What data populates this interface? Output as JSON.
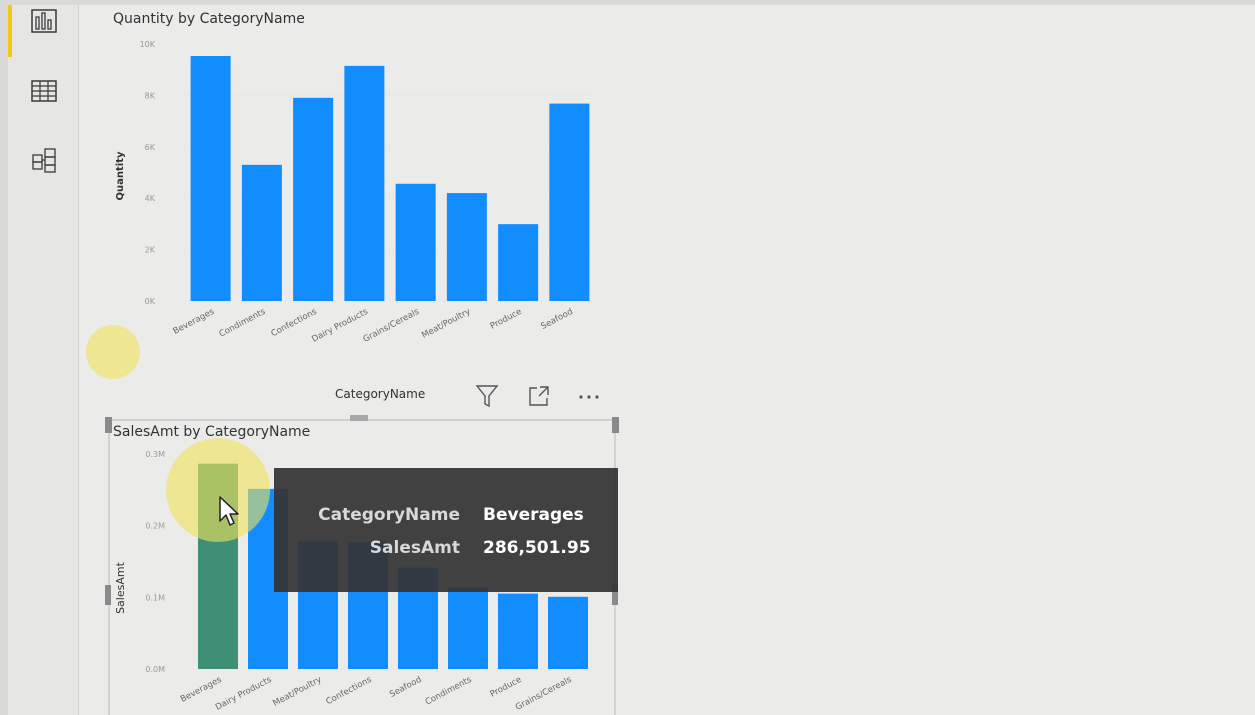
{
  "nav": {
    "items": [
      {
        "name": "report-view-icon",
        "active": true
      },
      {
        "name": "data-view-icon",
        "active": false
      },
      {
        "name": "model-view-icon",
        "active": false
      }
    ]
  },
  "colors": {
    "bar": "#118dff",
    "highlight": "#f2c811",
    "tooltip_bg": "#343434"
  },
  "visual_header": {
    "field_label": "CategoryName",
    "icons": [
      "filter-icon",
      "focus-mode-icon",
      "more-options-icon"
    ]
  },
  "tooltip": {
    "rows": [
      {
        "label": "CategoryName",
        "value": "Beverages"
      },
      {
        "label": "SalesAmt",
        "value": "286,501.95"
      }
    ]
  },
  "chart_data": [
    {
      "type": "bar",
      "title": "Quantity by CategoryName",
      "xlabel": "",
      "ylabel": "Quantity",
      "ylim": [
        0,
        10000
      ],
      "yticks": [
        "0K",
        "2K",
        "4K",
        "6K",
        "8K",
        "10K"
      ],
      "categories": [
        "Beverages",
        "Condiments",
        "Confections",
        "Dairy Products",
        "Grains/Cereals",
        "Meat/Poultry",
        "Produce",
        "Seafood"
      ],
      "values": [
        9532,
        5298,
        7906,
        9149,
        4562,
        4199,
        2990,
        7681
      ]
    },
    {
      "type": "bar",
      "title": "SalesAmt by CategoryName",
      "xlabel": "CategoryName",
      "ylabel": "SalesAmt",
      "ylim": [
        0,
        300000
      ],
      "yticks": [
        "0.0M",
        "0.1M",
        "0.2M",
        "0.3M"
      ],
      "categories": [
        "Beverages",
        "Dairy Products",
        "Meat/Poultry",
        "Confections",
        "Seafood",
        "Condiments",
        "Produce",
        "Grains/Cereals"
      ],
      "values": [
        286501.95,
        251330.5,
        178188.8,
        177099.1,
        141623.09,
        113694.75,
        105268.6,
        100726.8
      ]
    }
  ]
}
